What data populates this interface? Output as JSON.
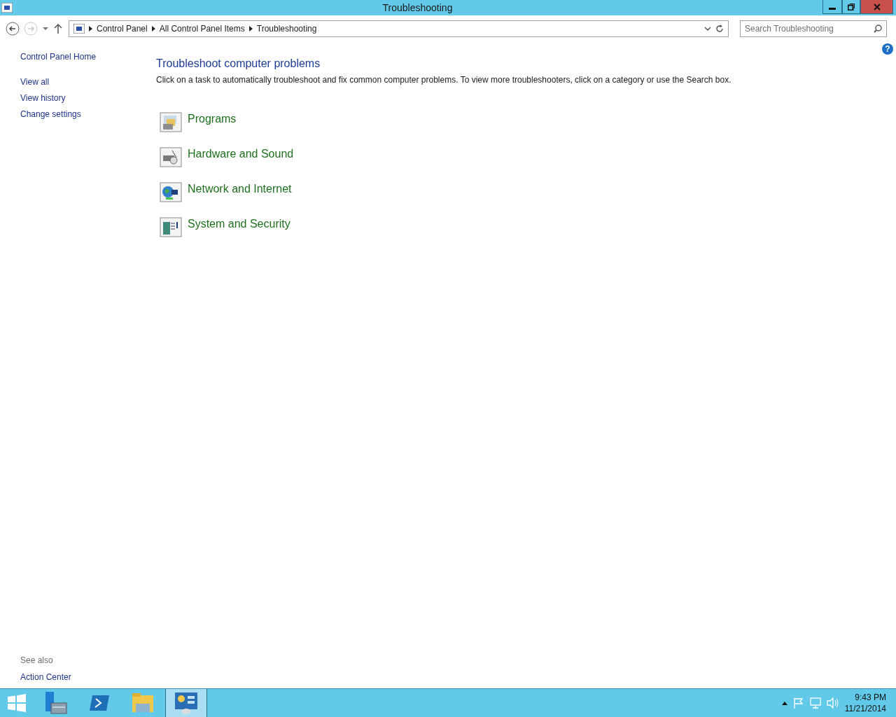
{
  "window": {
    "title": "Troubleshooting"
  },
  "address_bar": {
    "breadcrumbs": [
      "Control Panel",
      "All Control Panel Items",
      "Troubleshooting"
    ]
  },
  "search": {
    "placeholder": "Search Troubleshooting"
  },
  "help": {
    "label": "?"
  },
  "sidebar": {
    "items": [
      {
        "label": "Control Panel Home",
        "kind": "home"
      },
      {
        "label": "View all",
        "kind": "link"
      },
      {
        "label": "View history",
        "kind": "link"
      },
      {
        "label": "Change settings",
        "kind": "link"
      }
    ],
    "see_also": {
      "heading": "See also",
      "links": [
        "Action Center"
      ]
    }
  },
  "main": {
    "heading": "Troubleshoot computer problems",
    "description": "Click on a task to automatically troubleshoot and fix common computer problems. To view more troubleshooters, click on a category or use the Search box.",
    "categories": [
      {
        "label": "Programs",
        "kind": "programs"
      },
      {
        "label": "Hardware and Sound",
        "kind": "hardware"
      },
      {
        "label": "Network and Internet",
        "kind": "network"
      },
      {
        "label": "System and Security",
        "kind": "security"
      }
    ]
  },
  "taskbar": {
    "apps": [
      {
        "kind": "server",
        "selected": false
      },
      {
        "kind": "powershell",
        "selected": false
      },
      {
        "kind": "explorer",
        "selected": false
      },
      {
        "kind": "controlpanel",
        "selected": true
      }
    ],
    "clock": {
      "time": "9:43 PM",
      "date": "11/21/2014"
    }
  }
}
